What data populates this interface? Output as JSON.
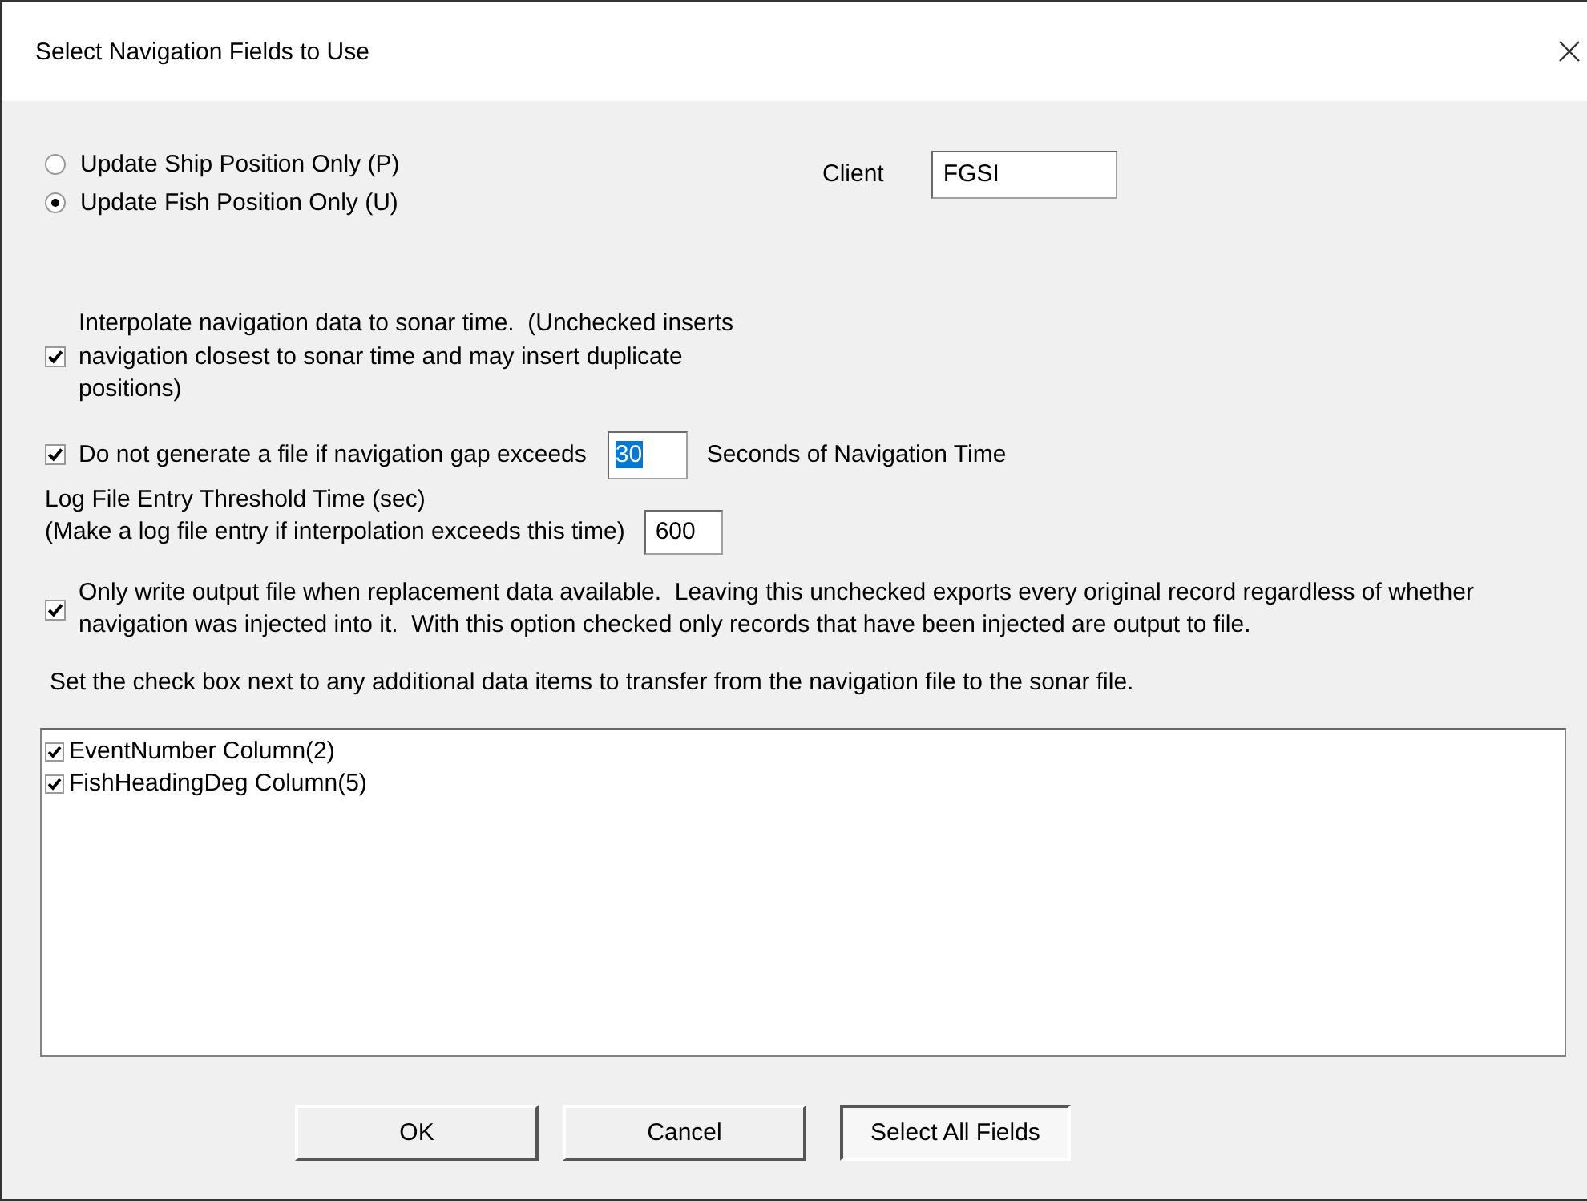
{
  "window": {
    "title": "Select Navigation Fields to Use"
  },
  "position_options": [
    {
      "label": "Update Ship Position Only (P)",
      "selected": false
    },
    {
      "label": "Update Fish Position Only (U)",
      "selected": true
    }
  ],
  "client": {
    "label": "Client",
    "value": "FGSI"
  },
  "interpolate": {
    "label": "Interpolate navigation data to sonar time.  (Unchecked inserts navigation closest to sonar time and may insert duplicate positions)",
    "checked": true
  },
  "gap": {
    "label": "Do not generate a file if navigation gap exceeds",
    "value": "30",
    "text_highlighted": true,
    "unit": "Seconds of Navigation Time",
    "checked": true
  },
  "log_threshold": {
    "label": "Log File Entry Threshold Time (sec)",
    "note": "(Make a log file entry if interpolation exceeds this time)",
    "value": "600"
  },
  "output_only": {
    "label": "Only write output file when replacement data available.  Leaving this unchecked exports every original record regardless of whether navigation was injected into it.  With this option checked only records that have been injected are output to file.",
    "checked": true
  },
  "instruction": "Set the check box next to any additional data items to transfer from the navigation file to the sonar file.",
  "items": [
    {
      "label": "EventNumber Column(2)",
      "checked": true
    },
    {
      "label": "FishHeadingDeg Column(5)",
      "checked": true
    }
  ],
  "buttons": [
    {
      "label": "OK",
      "kind": "raised"
    },
    {
      "label": "Cancel",
      "kind": "raised"
    },
    {
      "label": "Select All Fields",
      "kind": "sunken"
    }
  ]
}
